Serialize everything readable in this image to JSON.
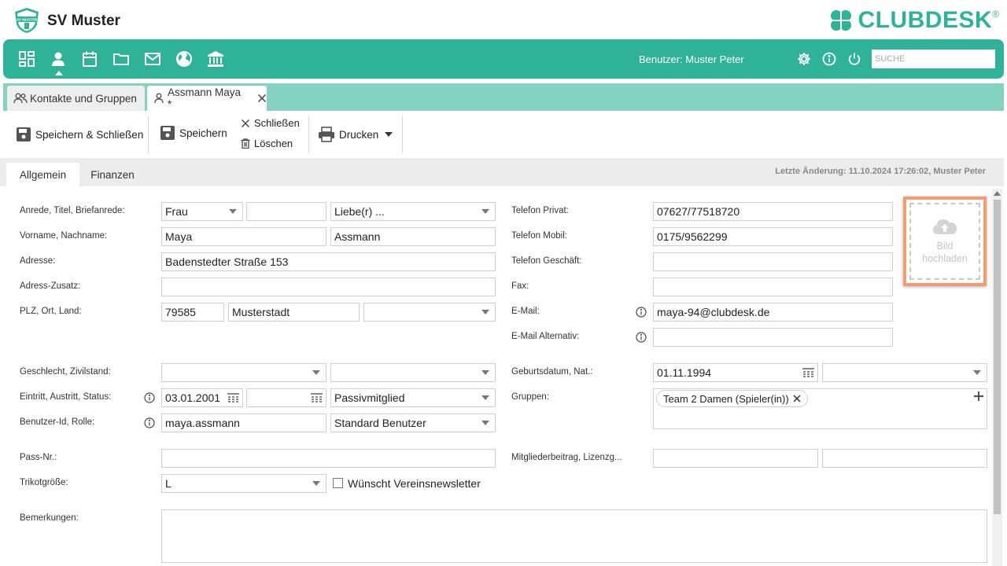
{
  "header": {
    "title": "SV Muster",
    "logo_text": "SV MUSTER",
    "brand": "CLUBDESK",
    "brand_mark": "®"
  },
  "topnav": {
    "icons": [
      "dashboard-icon",
      "person-icon",
      "calendar-icon",
      "folder-icon",
      "mail-icon",
      "globe-icon",
      "bank-icon"
    ],
    "user": "Benutzer: Muster Peter",
    "search_placeholder": "SUCHE"
  },
  "doc_tabs": [
    {
      "label": "Kontakte und Gruppen"
    },
    {
      "label": "Assmann Maya *"
    }
  ],
  "toolbar": {
    "save_close": "Speichern & Schließen",
    "save": "Speichern",
    "close": "Schließen",
    "delete": "Löschen",
    "print": "Drucken"
  },
  "section_tabs": [
    "Allgemein",
    "Finanzen"
  ],
  "last_change": "Letzte Änderung: 11.10.2024 17:26:02, Muster Peter",
  "labels": {
    "anrede": "Anrede, Titel, Briefanrede:",
    "name": "Vorname, Nachname:",
    "adresse": "Adresse:",
    "zusatz": "Adress-Zusatz:",
    "plz": "PLZ, Ort, Land:",
    "geschlecht": "Geschlecht, Zivilstand:",
    "eintritt": "Eintritt, Austritt, Status:",
    "benutzer": "Benutzer-Id, Rolle:",
    "pass": "Pass-Nr.:",
    "trikot": "Trikotgröße:",
    "bemerkungen": "Bemerkungen:",
    "tel_privat": "Telefon Privat:",
    "tel_mobil": "Telefon Mobil:",
    "tel_geschaeft": "Telefon Geschäft:",
    "fax": "Fax:",
    "email": "E-Mail:",
    "email_alt": "E-Mail Alternativ:",
    "geburt": "Geburtsdatum, Nat.:",
    "gruppen": "Gruppen:",
    "beitrag": "Mitgliederbeitrag, Lizenzg..."
  },
  "values": {
    "anrede": "Frau",
    "titel": "",
    "briefanrede": "Liebe(r) ...",
    "vorname": "Maya",
    "nachname": "Assmann",
    "adresse": "Badenstedter Straße 153",
    "zusatz": "",
    "plz": "79585",
    "ort": "Musterstadt",
    "land": "",
    "geschlecht": "",
    "zivilstand": "",
    "eintritt": "03.01.2001",
    "austritt": "",
    "status": "Passivmitglied",
    "benutzer_id": "maya.assmann",
    "rolle": "Standard Benutzer",
    "pass": "",
    "trikot": "L",
    "newsletter": "Wünscht Vereinsnewsletter",
    "tel_privat": "07627/77518720",
    "tel_mobil": "0175/9562299",
    "tel_geschaeft": "",
    "fax": "",
    "email": "maya-94@clubdesk.de",
    "email_alt": "",
    "geburt": "01.11.1994",
    "nationalitaet": "",
    "gruppe": "Team 2 Damen (Spieler(in))",
    "beitrag": "",
    "lizenz": ""
  },
  "upload": {
    "line1": "Bild",
    "line2": "hochladen"
  },
  "colors": {
    "accent": "#2eb398",
    "tabbar": "#84d3c0",
    "upload_border": "#f39c74"
  }
}
